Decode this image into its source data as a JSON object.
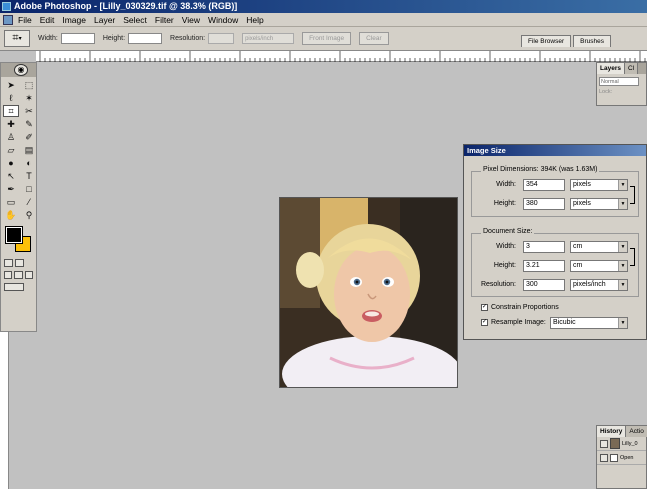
{
  "window": {
    "title": "Adobe Photoshop - [Lilly_030329.tif @ 38.3% (RGB)]"
  },
  "menu": {
    "items": [
      "File",
      "Edit",
      "Image",
      "Layer",
      "Select",
      "Filter",
      "View",
      "Window",
      "Help"
    ]
  },
  "options_bar": {
    "width_label": "Width:",
    "height_label": "Height:",
    "resolution_label": "Resolution:",
    "resolution_unit": "pixels/inch",
    "front_image": "Front Image",
    "clear": "Clear",
    "wells": [
      "File Browser",
      "Brushes"
    ]
  },
  "toolbox": {
    "icons": [
      "move-icon",
      "marquee-icon",
      "lasso-icon",
      "magic-wand-icon",
      "crop-icon",
      "slice-icon",
      "healing-brush-icon",
      "brush-icon",
      "clone-stamp-icon",
      "history-brush-icon",
      "eraser-icon",
      "gradient-icon",
      "blur-icon",
      "dodge-icon",
      "path-select-icon",
      "type-icon",
      "pen-icon",
      "shape-icon",
      "notes-icon",
      "eyedropper-icon",
      "hand-icon",
      "zoom-icon"
    ],
    "foreground_color": "#000000",
    "background_color": "#fcc10a"
  },
  "image_size_dialog": {
    "title": "Image Size",
    "pixel_dimensions": {
      "label": "Pixel Dimensions:",
      "size": "394K (was 1.63M)",
      "width_label": "Width:",
      "width_value": "354",
      "width_unit": "pixels",
      "height_label": "Height:",
      "height_value": "380",
      "height_unit": "pixels"
    },
    "document_size": {
      "label": "Document Size:",
      "width_label": "Width:",
      "width_value": "3",
      "width_unit": "cm",
      "height_label": "Height:",
      "height_value": "3.21",
      "height_unit": "cm",
      "resolution_label": "Resolution:",
      "resolution_value": "300",
      "resolution_unit": "pixels/inch"
    },
    "constrain_proportions": "Constrain Proportions",
    "resample_label": "Resample Image:",
    "resample_value": "Bicubic"
  },
  "layers_palette": {
    "tabs": [
      "Layers",
      "Cl"
    ],
    "blend_mode": "Normal",
    "lock_label": "Lock:"
  },
  "history_palette": {
    "tabs": [
      "History",
      "Actio"
    ],
    "items": [
      "Lilly_0",
      "Open"
    ]
  }
}
